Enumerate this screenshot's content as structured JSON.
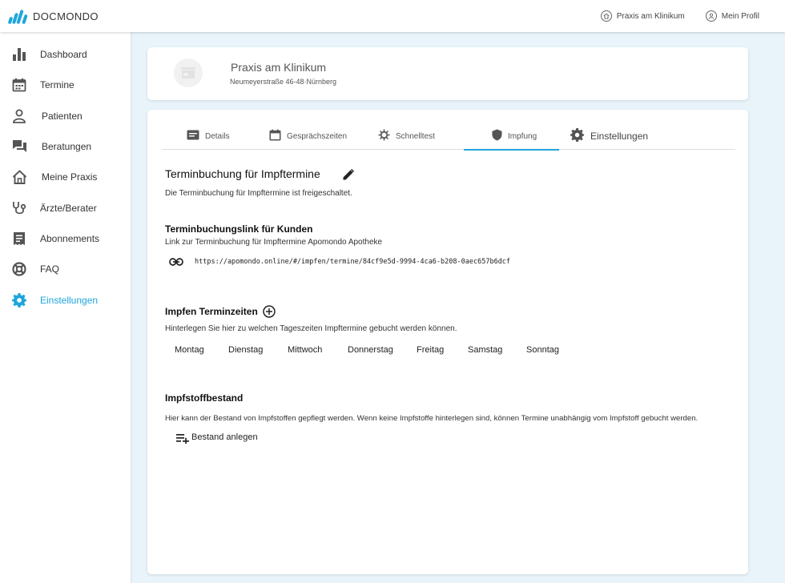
{
  "app": {
    "logo_text": "DOCMONDO"
  },
  "topbar": {
    "praxis_label": "Praxis am Klinikum",
    "profile_label": "Mein Profil"
  },
  "sidebar": {
    "items": [
      {
        "label": "Dashboard",
        "icon": "bar-chart-icon"
      },
      {
        "label": "Termine",
        "icon": "calendar-icon"
      },
      {
        "label": "Patienten",
        "icon": "person-icon"
      },
      {
        "label": "Beratungen",
        "icon": "chat-icon"
      },
      {
        "label": "Meine Praxis",
        "icon": "house-icon"
      },
      {
        "label": "Ärzte/Berater",
        "icon": "stethoscope-icon"
      },
      {
        "label": "Abonnements",
        "icon": "receipt-icon"
      },
      {
        "label": "FAQ",
        "icon": "lifebuoy-icon"
      },
      {
        "label": "Einstellungen",
        "icon": "gear-icon",
        "active": true
      }
    ]
  },
  "header": {
    "name": "Praxis am Klinikum",
    "address": "Neumeyerstraße 46-48·Nürnberg"
  },
  "tabs": [
    {
      "label": "Details",
      "icon": "card-icon"
    },
    {
      "label": "Gesprächszeiten",
      "icon": "calendar-icon"
    },
    {
      "label": "Schnelltest",
      "icon": "virus-icon"
    },
    {
      "label": "Impfung",
      "icon": "shield-icon",
      "active": true
    },
    {
      "label": "Einstellungen",
      "icon": "gear-icon"
    }
  ],
  "section1": {
    "title": "Terminbuchung für Impftermine",
    "desc": "Die Terminbuchung für Impftermine ist freigeschaltet."
  },
  "section2": {
    "title": "Terminbuchungslink für Kunden",
    "desc": "Link zur Terminbuchung für Impftermine Apomondo Apotheke",
    "link": "https://apomondo.online/#/impfen/termine/84cf9e5d-9994-4ca6-b208-0aec657b6dcf"
  },
  "section3": {
    "title": "Impfen Terminzeiten",
    "desc": "Hinterlegen Sie hier zu welchen Tageszeiten Impftermine gebucht werden können.",
    "days": [
      "Montag",
      "Dienstag",
      "Mittwoch",
      "Donnerstag",
      "Freitag",
      "Samstag",
      "Sonntag"
    ]
  },
  "section4": {
    "title": "Impfstoffbestand",
    "desc": "Hier kann der Bestand von Impfstoffen gepflegt werden. Wenn keine Impfstoffe hinterlegen sind, können Termine unabhängig vom Impfstoff gebucht werden.",
    "button": "Bestand anlegen"
  },
  "colors": {
    "accent": "#1ea6dc",
    "background": "#e8f4fa"
  }
}
